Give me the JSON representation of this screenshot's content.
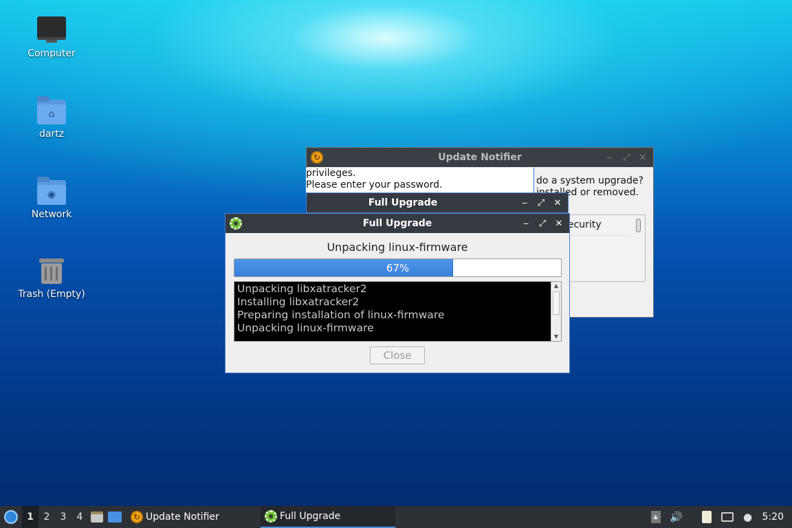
{
  "desktop": {
    "icons": [
      {
        "label": "Computer"
      },
      {
        "label": "dartz"
      },
      {
        "label": "Network"
      },
      {
        "label": "Trash (Empty)"
      }
    ]
  },
  "update_notifier": {
    "title": "Update Notifier",
    "right_text_1": "do a system upgrade?",
    "right_text_2": "installed or removed.",
    "list_item": "ecurity"
  },
  "auth": {
    "line1": "privileges.",
    "line2": "Please enter your password."
  },
  "upgrade_back": {
    "title": "Full Upgrade"
  },
  "upgrade": {
    "title": "Full Upgrade",
    "status": "Unpacking linux-firmware",
    "progress_fraction": 0.67,
    "progress_label": "67%",
    "log": [
      "Unpacking libxatracker2",
      "Installing libxatracker2",
      "Preparing installation of linux-firmware",
      "Unpacking linux-firmware"
    ],
    "close_label": "Close"
  },
  "taskbar": {
    "workspaces": [
      "1",
      "2",
      "3",
      "4"
    ],
    "tasks": [
      {
        "label": "Update Notifier",
        "icon": "update-icon"
      },
      {
        "label": "Full Upgrade",
        "icon": "gear-icon"
      }
    ],
    "clock": "5:20"
  },
  "window_controls": {
    "minimize": "‒",
    "maximize": "⤢",
    "close": "✕"
  }
}
